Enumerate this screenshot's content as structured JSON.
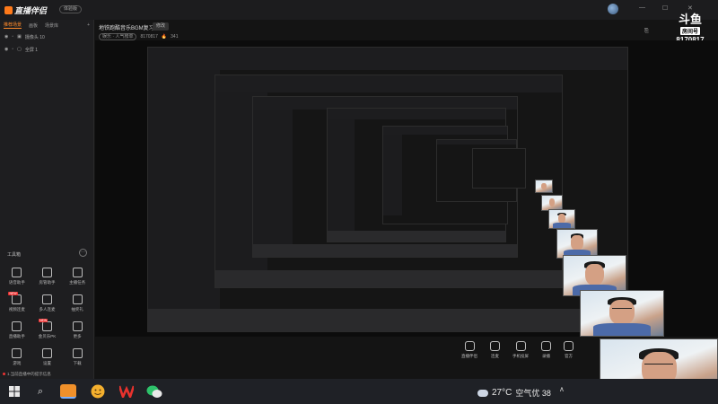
{
  "app": {
    "logo_text": "直播伴侣",
    "version_label": "体验版"
  },
  "sidebar": {
    "tabs": [
      {
        "label": "推荐场景"
      },
      {
        "label": "画板"
      },
      {
        "label": "场景库"
      }
    ],
    "sources": [
      {
        "label": "摄像头 10"
      },
      {
        "label": "全屏 1"
      }
    ],
    "tools_title": "工具箱",
    "tools_help": "···",
    "tools": [
      {
        "label": "语音助手",
        "icon": "chat-icon",
        "badge": ""
      },
      {
        "label": "房管助手",
        "icon": "user-shield-icon",
        "badge": ""
      },
      {
        "label": "主播任务",
        "icon": "task-icon",
        "badge": ""
      },
      {
        "label": "视频连麦",
        "icon": "link-icon",
        "badge": "NEW"
      },
      {
        "label": "多人连麦",
        "icon": "group-icon",
        "badge": ""
      },
      {
        "label": "抽奖礼",
        "icon": "gift-icon",
        "badge": ""
      },
      {
        "label": "直播助手",
        "icon": "assistant-icon",
        "badge": ""
      },
      {
        "label": "金贝乐PK",
        "icon": "pk-icon",
        "badge": "NEW"
      },
      {
        "label": "更多",
        "icon": "more-icon",
        "badge": ""
      },
      {
        "label": "游戏",
        "icon": "game-icon",
        "badge": ""
      },
      {
        "label": "设置",
        "icon": "settings-icon",
        "badge": ""
      },
      {
        "label": "下载",
        "icon": "download-icon",
        "badge": ""
      }
    ],
    "footer": "1.当前直播中的提示信息"
  },
  "header": {
    "title": "地铁跑酷音乐BGM复习",
    "tag": "修改",
    "meta_category": "娱乐 · 人气榜单",
    "meta_id": "8170817",
    "meta_heat": "341"
  },
  "douyu_badge": {
    "logo": "斗鱼",
    "sub": "房间号",
    "room_id": "8170817"
  },
  "toolbar": [
    {
      "label": "直播伴侣",
      "icon": "broadcast-icon"
    },
    {
      "label": "连麦",
      "icon": "mic-link-icon"
    },
    {
      "label": "手机投屏",
      "icon": "phone-cast-icon"
    },
    {
      "label": "录播",
      "icon": "record-icon"
    },
    {
      "label": "官方",
      "icon": "official-icon"
    }
  ],
  "taskbar": {
    "weather_temp": "27°C",
    "weather_aq": "空气优 38",
    "apps": [
      {
        "name": "直播伴侣",
        "icon": "app-orange-icon"
      },
      {
        "name": "表情",
        "icon": "app-face-icon"
      },
      {
        "name": "WPS",
        "icon": "app-wps-icon"
      },
      {
        "name": "微信",
        "icon": "app-wechat-icon"
      }
    ]
  },
  "colors": {
    "accent": "#ff8a2a",
    "background": "#141414",
    "taskbar": "#1f2126"
  }
}
